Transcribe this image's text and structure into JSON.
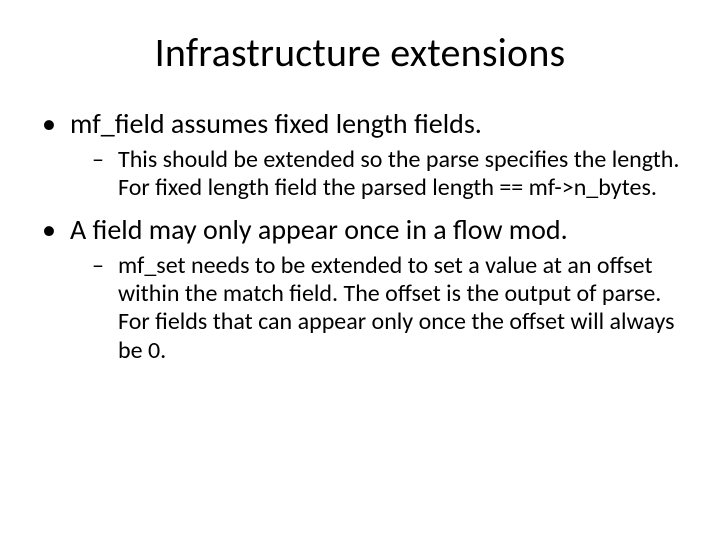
{
  "title": "Infrastructure extensions",
  "bullets": [
    {
      "text": "mf_field assumes fixed length fields.",
      "sub": [
        "This should be extended so the parse specifies the length. For fixed length field the parsed length == mf->n_bytes."
      ]
    },
    {
      "text": "A field may only appear once in a flow mod.",
      "sub": [
        "mf_set needs to be extended to set a value at an offset within the match field. The offset is the output of parse. For fields that can appear only once the offset will always be 0."
      ]
    }
  ]
}
